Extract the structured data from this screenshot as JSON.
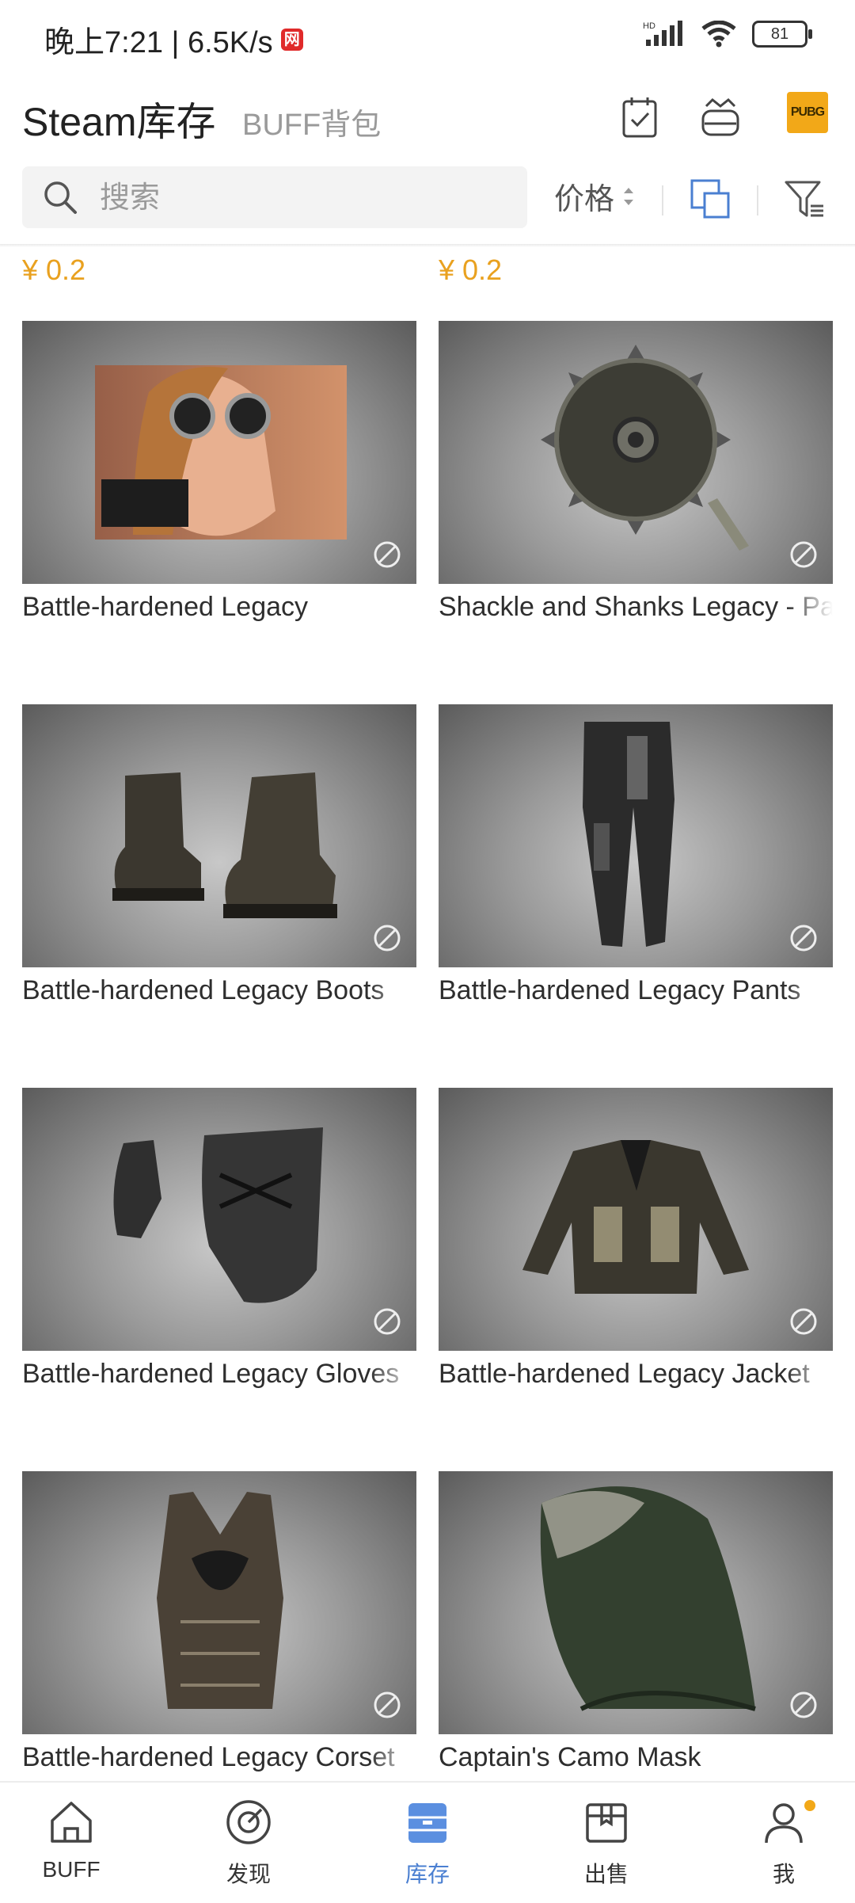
{
  "status_bar": {
    "time": "晚上7:21 | 6.5K/s",
    "app_badge": "网",
    "network": "HD",
    "battery": "81"
  },
  "header": {
    "title": "Steam库存",
    "subtitle": "BUFF背包",
    "game_logo": "PUBG"
  },
  "search": {
    "placeholder": "搜索",
    "value": ""
  },
  "sort": {
    "label": "价格"
  },
  "prices": [
    "¥ 0.2",
    "¥ 0.2"
  ],
  "items": [
    {
      "name": "Battle-hardened Legacy",
      "icon": "portrait-goggles"
    },
    {
      "name": "Shackle and Shanks Legacy - Pa",
      "icon": "sawblade"
    },
    {
      "name": "Battle-hardened Legacy Boots",
      "icon": "boots"
    },
    {
      "name": "Battle-hardened Legacy Pants",
      "icon": "pants"
    },
    {
      "name": "Battle-hardened Legacy Gloves",
      "icon": "gloves"
    },
    {
      "name": "Battle-hardened Legacy Jacket",
      "icon": "jacket"
    },
    {
      "name": "Battle-hardened Legacy Corset",
      "icon": "corset"
    },
    {
      "name": "Captain's Camo Mask",
      "icon": "mask"
    }
  ],
  "nav": [
    {
      "label": "BUFF",
      "icon": "home-icon"
    },
    {
      "label": "发现",
      "icon": "discover-icon"
    },
    {
      "label": "库存",
      "icon": "inventory-icon",
      "active": true
    },
    {
      "label": "出售",
      "icon": "sell-icon"
    },
    {
      "label": "我",
      "icon": "profile-icon"
    }
  ],
  "colors": {
    "price": "#e9a11f",
    "accent": "#4a7fd1",
    "pubg": "#f2a818"
  }
}
